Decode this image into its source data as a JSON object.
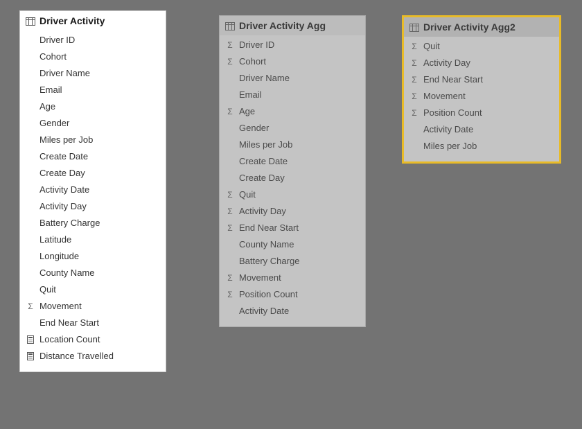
{
  "tables": [
    {
      "name": "Driver Activity",
      "style": "card1",
      "fields": [
        {
          "icon": "none",
          "label": "Driver ID"
        },
        {
          "icon": "none",
          "label": "Cohort"
        },
        {
          "icon": "none",
          "label": "Driver Name"
        },
        {
          "icon": "none",
          "label": "Email"
        },
        {
          "icon": "none",
          "label": "Age"
        },
        {
          "icon": "none",
          "label": "Gender"
        },
        {
          "icon": "none",
          "label": "Miles per Job"
        },
        {
          "icon": "none",
          "label": "Create Date"
        },
        {
          "icon": "none",
          "label": "Create Day"
        },
        {
          "icon": "none",
          "label": "Activity Date"
        },
        {
          "icon": "none",
          "label": "Activity Day"
        },
        {
          "icon": "none",
          "label": "Battery Charge"
        },
        {
          "icon": "none",
          "label": "Latitude"
        },
        {
          "icon": "none",
          "label": "Longitude"
        },
        {
          "icon": "none",
          "label": "County Name"
        },
        {
          "icon": "none",
          "label": "Quit"
        },
        {
          "icon": "sigma",
          "label": "Movement"
        },
        {
          "icon": "none",
          "label": "End Near Start"
        },
        {
          "icon": "calc",
          "label": "Location Count"
        },
        {
          "icon": "calc",
          "label": "Distance Travelled"
        }
      ]
    },
    {
      "name": "Driver Activity Agg",
      "style": "card2",
      "fields": [
        {
          "icon": "sigma",
          "label": "Driver ID"
        },
        {
          "icon": "sigma",
          "label": "Cohort"
        },
        {
          "icon": "none",
          "label": "Driver Name"
        },
        {
          "icon": "none",
          "label": "Email"
        },
        {
          "icon": "sigma",
          "label": "Age"
        },
        {
          "icon": "none",
          "label": "Gender"
        },
        {
          "icon": "none",
          "label": "Miles per Job"
        },
        {
          "icon": "none",
          "label": "Create Date"
        },
        {
          "icon": "none",
          "label": "Create Day"
        },
        {
          "icon": "sigma",
          "label": "Quit"
        },
        {
          "icon": "sigma",
          "label": "Activity Day"
        },
        {
          "icon": "sigma",
          "label": "End Near Start"
        },
        {
          "icon": "none",
          "label": "County Name"
        },
        {
          "icon": "none",
          "label": "Battery Charge"
        },
        {
          "icon": "sigma",
          "label": "Movement"
        },
        {
          "icon": "sigma",
          "label": "Position Count"
        },
        {
          "icon": "none",
          "label": "Activity Date"
        }
      ]
    },
    {
      "name": "Driver Activity Agg2",
      "style": "card3",
      "fields": [
        {
          "icon": "sigma",
          "label": "Quit"
        },
        {
          "icon": "sigma",
          "label": "Activity Day"
        },
        {
          "icon": "sigma",
          "label": "End Near Start"
        },
        {
          "icon": "sigma",
          "label": "Movement"
        },
        {
          "icon": "sigma",
          "label": "Position Count"
        },
        {
          "icon": "none",
          "label": "Activity Date"
        },
        {
          "icon": "none",
          "label": "Miles per Job"
        }
      ]
    }
  ]
}
